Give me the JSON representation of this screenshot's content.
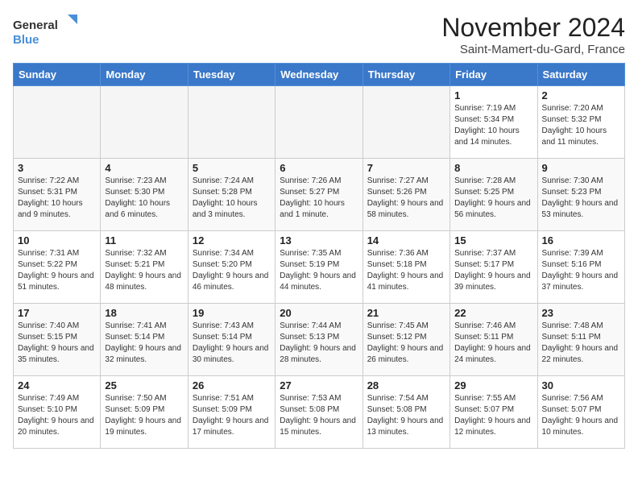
{
  "logo": {
    "line1": "General",
    "line2": "Blue"
  },
  "title": "November 2024",
  "subtitle": "Saint-Mamert-du-Gard, France",
  "headers": [
    "Sunday",
    "Monday",
    "Tuesday",
    "Wednesday",
    "Thursday",
    "Friday",
    "Saturday"
  ],
  "weeks": [
    [
      {
        "day": "",
        "detail": ""
      },
      {
        "day": "",
        "detail": ""
      },
      {
        "day": "",
        "detail": ""
      },
      {
        "day": "",
        "detail": ""
      },
      {
        "day": "",
        "detail": ""
      },
      {
        "day": "1",
        "detail": "Sunrise: 7:19 AM\nSunset: 5:34 PM\nDaylight: 10 hours and 14 minutes."
      },
      {
        "day": "2",
        "detail": "Sunrise: 7:20 AM\nSunset: 5:32 PM\nDaylight: 10 hours and 11 minutes."
      }
    ],
    [
      {
        "day": "3",
        "detail": "Sunrise: 7:22 AM\nSunset: 5:31 PM\nDaylight: 10 hours and 9 minutes."
      },
      {
        "day": "4",
        "detail": "Sunrise: 7:23 AM\nSunset: 5:30 PM\nDaylight: 10 hours and 6 minutes."
      },
      {
        "day": "5",
        "detail": "Sunrise: 7:24 AM\nSunset: 5:28 PM\nDaylight: 10 hours and 3 minutes."
      },
      {
        "day": "6",
        "detail": "Sunrise: 7:26 AM\nSunset: 5:27 PM\nDaylight: 10 hours and 1 minute."
      },
      {
        "day": "7",
        "detail": "Sunrise: 7:27 AM\nSunset: 5:26 PM\nDaylight: 9 hours and 58 minutes."
      },
      {
        "day": "8",
        "detail": "Sunrise: 7:28 AM\nSunset: 5:25 PM\nDaylight: 9 hours and 56 minutes."
      },
      {
        "day": "9",
        "detail": "Sunrise: 7:30 AM\nSunset: 5:23 PM\nDaylight: 9 hours and 53 minutes."
      }
    ],
    [
      {
        "day": "10",
        "detail": "Sunrise: 7:31 AM\nSunset: 5:22 PM\nDaylight: 9 hours and 51 minutes."
      },
      {
        "day": "11",
        "detail": "Sunrise: 7:32 AM\nSunset: 5:21 PM\nDaylight: 9 hours and 48 minutes."
      },
      {
        "day": "12",
        "detail": "Sunrise: 7:34 AM\nSunset: 5:20 PM\nDaylight: 9 hours and 46 minutes."
      },
      {
        "day": "13",
        "detail": "Sunrise: 7:35 AM\nSunset: 5:19 PM\nDaylight: 9 hours and 44 minutes."
      },
      {
        "day": "14",
        "detail": "Sunrise: 7:36 AM\nSunset: 5:18 PM\nDaylight: 9 hours and 41 minutes."
      },
      {
        "day": "15",
        "detail": "Sunrise: 7:37 AM\nSunset: 5:17 PM\nDaylight: 9 hours and 39 minutes."
      },
      {
        "day": "16",
        "detail": "Sunrise: 7:39 AM\nSunset: 5:16 PM\nDaylight: 9 hours and 37 minutes."
      }
    ],
    [
      {
        "day": "17",
        "detail": "Sunrise: 7:40 AM\nSunset: 5:15 PM\nDaylight: 9 hours and 35 minutes."
      },
      {
        "day": "18",
        "detail": "Sunrise: 7:41 AM\nSunset: 5:14 PM\nDaylight: 9 hours and 32 minutes."
      },
      {
        "day": "19",
        "detail": "Sunrise: 7:43 AM\nSunset: 5:14 PM\nDaylight: 9 hours and 30 minutes."
      },
      {
        "day": "20",
        "detail": "Sunrise: 7:44 AM\nSunset: 5:13 PM\nDaylight: 9 hours and 28 minutes."
      },
      {
        "day": "21",
        "detail": "Sunrise: 7:45 AM\nSunset: 5:12 PM\nDaylight: 9 hours and 26 minutes."
      },
      {
        "day": "22",
        "detail": "Sunrise: 7:46 AM\nSunset: 5:11 PM\nDaylight: 9 hours and 24 minutes."
      },
      {
        "day": "23",
        "detail": "Sunrise: 7:48 AM\nSunset: 5:11 PM\nDaylight: 9 hours and 22 minutes."
      }
    ],
    [
      {
        "day": "24",
        "detail": "Sunrise: 7:49 AM\nSunset: 5:10 PM\nDaylight: 9 hours and 20 minutes."
      },
      {
        "day": "25",
        "detail": "Sunrise: 7:50 AM\nSunset: 5:09 PM\nDaylight: 9 hours and 19 minutes."
      },
      {
        "day": "26",
        "detail": "Sunrise: 7:51 AM\nSunset: 5:09 PM\nDaylight: 9 hours and 17 minutes."
      },
      {
        "day": "27",
        "detail": "Sunrise: 7:53 AM\nSunset: 5:08 PM\nDaylight: 9 hours and 15 minutes."
      },
      {
        "day": "28",
        "detail": "Sunrise: 7:54 AM\nSunset: 5:08 PM\nDaylight: 9 hours and 13 minutes."
      },
      {
        "day": "29",
        "detail": "Sunrise: 7:55 AM\nSunset: 5:07 PM\nDaylight: 9 hours and 12 minutes."
      },
      {
        "day": "30",
        "detail": "Sunrise: 7:56 AM\nSunset: 5:07 PM\nDaylight: 9 hours and 10 minutes."
      }
    ]
  ]
}
